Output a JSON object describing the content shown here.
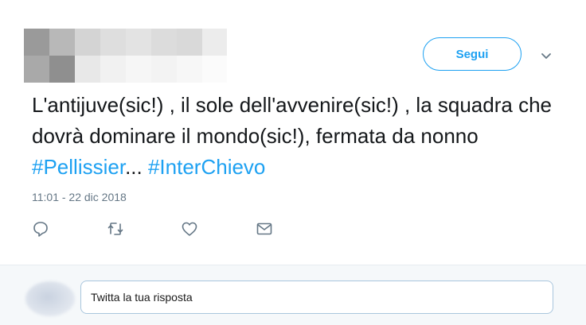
{
  "header": {
    "follow_label": "Segui"
  },
  "tweet": {
    "text_segments": [
      "L'antijuve(sic!) , il sole dell'avvenire(sic!) , la squadra che dovrà dominare il mondo(sic!), fermata da nonno "
    ],
    "hashtag_1": "#Pellissier",
    "ellipsis": "... ",
    "hashtag_2": "#InterChievo",
    "timestamp": "11:01 - 22 dic 2018"
  },
  "actions": {
    "icons": [
      "reply-icon",
      "retweet-icon",
      "like-icon",
      "direct-message-icon"
    ]
  },
  "reply": {
    "placeholder": "Twitta la tua risposta"
  },
  "colors": {
    "accent": "#1da1f2",
    "text": "#14171a",
    "muted": "#657786",
    "reply_bar_bg": "#f5f8fa"
  }
}
